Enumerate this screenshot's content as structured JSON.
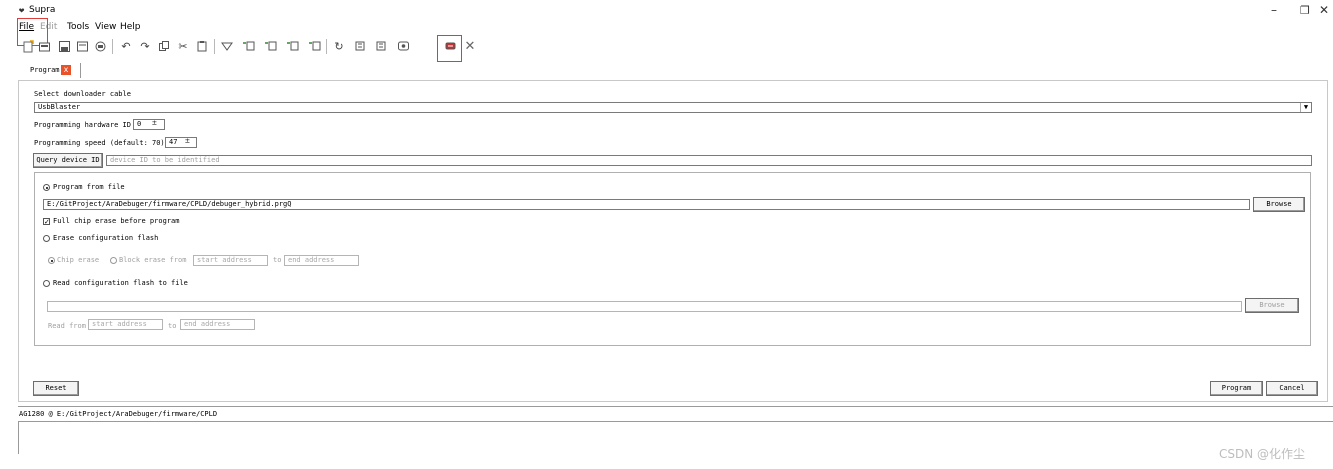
{
  "window": {
    "title": "Supra",
    "min": "–",
    "max": "❐",
    "close": "✕"
  },
  "menu": {
    "file": "File",
    "edit": "Edit",
    "tools": "Tools",
    "view": "View",
    "help": "Help"
  },
  "tab": {
    "label": "Program",
    "close": "x"
  },
  "cable": {
    "label": "Select downloader cable",
    "value": "UsbBlaster"
  },
  "hardware_id": {
    "label": "Programming hardware ID",
    "value": "0"
  },
  "speed": {
    "label": "Programming speed (default: 70)",
    "value": "47"
  },
  "query": {
    "button": "Query device ID",
    "placeholder": "device ID to be identified"
  },
  "program_file": {
    "label": "Program from file",
    "path": "E:/GitProject/AraDebuger/firmware/CPLD/debuger_hybrid.prgQ",
    "browse": "Browse",
    "checked": true
  },
  "full_erase": {
    "label": "Full chip erase before program",
    "checked": true
  },
  "erase_flash": {
    "label": "Erase configuration flash",
    "chip_erase": "Chip erase",
    "block_erase": "Block erase from",
    "start_placeholder": "start address",
    "to": "to",
    "end_placeholder": "end address"
  },
  "read_flash": {
    "label": "Read configuration flash to file",
    "browse": "Browse",
    "read_from": "Read from",
    "start_placeholder": "start address",
    "to": "to",
    "end_placeholder": "end address"
  },
  "buttons": {
    "reset": "Reset",
    "program": "Program",
    "cancel": "Cancel"
  },
  "status": "AG1280 @ E:/GitProject/AraDebuger/firmware/CPLD",
  "watermark": "CSDN @化作尘",
  "colors": {
    "highlight_box": "#e03b3b",
    "tab_close": "#e8512a"
  }
}
